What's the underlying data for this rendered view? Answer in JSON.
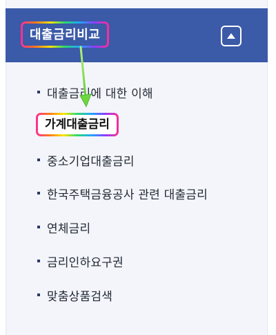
{
  "menu": {
    "title": "대출금리비교",
    "collapse_icon": "chevron-up-icon",
    "items": [
      {
        "label": "대출금리에 대한 이해"
      },
      {
        "label": "가계대출금리",
        "active": true
      },
      {
        "label": "중소기업대출금리"
      },
      {
        "label": "한국주택금융공사 관련 대출금리"
      },
      {
        "label": "연체금리"
      },
      {
        "label": "금리인하요구권"
      },
      {
        "label": "맞춤상품검색"
      }
    ]
  },
  "colors": {
    "header_bg": "#3b5aa8",
    "panel_bg": "#f3f5fa",
    "text": "#222933",
    "arrow": "#7ed957"
  }
}
